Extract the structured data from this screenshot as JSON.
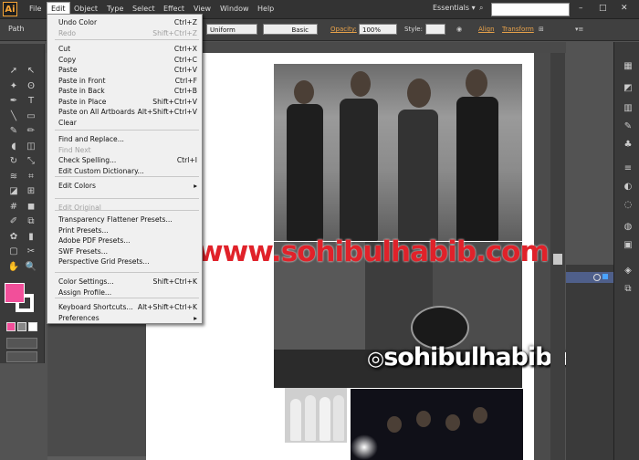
{
  "menubar": {
    "logo": "Ai",
    "items": [
      "File",
      "Edit",
      "Object",
      "Type",
      "Select",
      "Effect",
      "View",
      "Window",
      "Help"
    ],
    "workspace": "Essentials",
    "window_controls": [
      "–",
      "□",
      "✕"
    ]
  },
  "controlbar": {
    "path": "Path",
    "stroke_profile": "Uniform",
    "brush": "Basic",
    "opacity_label": "Opacity:",
    "opacity_value": "100%",
    "style_label": "Style:",
    "align": "Align",
    "transform": "Transform"
  },
  "edit_menu": {
    "groups": [
      [
        {
          "label": "Undo Color",
          "shortcut": "Ctrl+Z",
          "enabled": true
        },
        {
          "label": "Redo",
          "shortcut": "Shift+Ctrl+Z",
          "enabled": false
        }
      ],
      [
        {
          "label": "Cut",
          "shortcut": "Ctrl+X",
          "enabled": true
        },
        {
          "label": "Copy",
          "shortcut": "Ctrl+C",
          "enabled": true
        },
        {
          "label": "Paste",
          "shortcut": "Ctrl+V",
          "enabled": true
        },
        {
          "label": "Paste in Front",
          "shortcut": "Ctrl+F",
          "enabled": true
        },
        {
          "label": "Paste in Back",
          "shortcut": "Ctrl+B",
          "enabled": true
        },
        {
          "label": "Paste in Place",
          "shortcut": "Shift+Ctrl+V",
          "enabled": true
        },
        {
          "label": "Paste on All Artboards",
          "shortcut": "Alt+Shift+Ctrl+V",
          "enabled": true
        },
        {
          "label": "Clear",
          "shortcut": "",
          "enabled": true
        }
      ],
      [
        {
          "label": "Find and Replace...",
          "shortcut": "",
          "enabled": true
        },
        {
          "label": "Find Next",
          "shortcut": "",
          "enabled": false
        },
        {
          "label": "Check Spelling...",
          "shortcut": "Ctrl+I",
          "enabled": true
        },
        {
          "label": "Edit Custom Dictionary...",
          "shortcut": "",
          "enabled": true
        }
      ],
      [
        {
          "label": "Edit Colors",
          "shortcut": "▸",
          "enabled": true
        }
      ],
      [
        {
          "label": "Edit Original",
          "shortcut": "",
          "enabled": false
        }
      ],
      [
        {
          "label": "Transparency Flattener Presets...",
          "shortcut": "",
          "enabled": true
        },
        {
          "label": "Print Presets...",
          "shortcut": "",
          "enabled": true
        },
        {
          "label": "Adobe PDF Presets...",
          "shortcut": "",
          "enabled": true
        },
        {
          "label": "SWF Presets...",
          "shortcut": "",
          "enabled": true
        },
        {
          "label": "Perspective Grid Presets...",
          "shortcut": "",
          "enabled": true
        }
      ],
      [
        {
          "label": "Color Settings...",
          "shortcut": "Shift+Ctrl+K",
          "enabled": true
        },
        {
          "label": "Assign Profile...",
          "shortcut": "",
          "enabled": true
        }
      ],
      [
        {
          "label": "Keyboard Shortcuts...",
          "shortcut": "Alt+Shift+Ctrl+K",
          "enabled": true
        },
        {
          "label": "Preferences",
          "shortcut": "▸",
          "enabled": true
        }
      ]
    ]
  },
  "watermarks": [
    "www.sohibulhabib.com",
    "sohibulhabib.com"
  ],
  "colors": {
    "fill": "#f24f9a",
    "watermark_red": "#e0222a",
    "app_bg": "#535353"
  },
  "tools": [
    "selection-icon",
    "direct-selection-icon",
    "magic-wand-icon",
    "lasso-icon",
    "pen-icon",
    "type-icon",
    "line-icon",
    "rectangle-icon",
    "paintbrush-icon",
    "pencil-icon",
    "blob-brush-icon",
    "eraser-icon",
    "rotate-icon",
    "scale-icon",
    "width-icon",
    "free-transform-icon",
    "shape-builder-icon",
    "perspective-grid-icon",
    "mesh-icon",
    "gradient-icon",
    "eyedropper-icon",
    "blend-icon",
    "symbol-sprayer-icon",
    "graph-icon",
    "artboard-icon",
    "slice-icon",
    "hand-icon",
    "zoom-icon"
  ]
}
